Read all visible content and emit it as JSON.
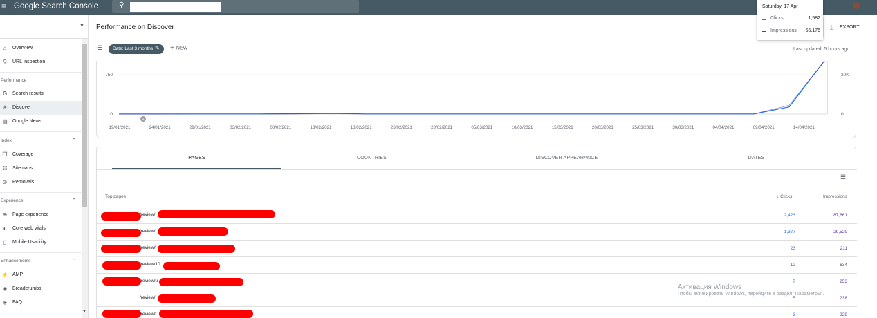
{
  "app": {
    "title": "Google Search Console"
  },
  "search": {
    "placeholder": ""
  },
  "tooltip": {
    "date": "Saturday, 17 Apr",
    "rows": [
      {
        "label": "Clicks",
        "value": "1,582"
      },
      {
        "label": "Impressions",
        "value": "55,176"
      }
    ]
  },
  "nav": {
    "items": [
      {
        "label": "Overview",
        "icon": "home-icon"
      },
      {
        "label": "URL inspection",
        "icon": "search-icon"
      },
      {
        "label": "Search results",
        "icon": "google-g-icon"
      },
      {
        "label": "Discover",
        "icon": "asterisk-icon"
      },
      {
        "label": "Google News",
        "icon": "news-icon"
      },
      {
        "label": "Coverage",
        "icon": "copy-icon"
      },
      {
        "label": "Sitemaps",
        "icon": "sitemap-icon"
      },
      {
        "label": "Removals",
        "icon": "eye-off-icon"
      },
      {
        "label": "Page experience",
        "icon": "plus-circle-icon"
      },
      {
        "label": "Core web vitals",
        "icon": "gauge-icon"
      },
      {
        "label": "Mobile Usability",
        "icon": "phone-icon"
      },
      {
        "label": "AMP",
        "icon": "bolt-icon"
      },
      {
        "label": "Breadcrumbs",
        "icon": "layers-icon"
      },
      {
        "label": "FAQ",
        "icon": "layers-icon"
      }
    ],
    "sections": [
      "Performance",
      "Index",
      "Experience",
      "Enhancements"
    ]
  },
  "header": {
    "title": "Performance on Discover",
    "export_label": "EXPORT",
    "last_updated": "Last updated: 5 hours ago"
  },
  "filters": {
    "date_chip": "Date: Last 3 months",
    "new_label": "NEW"
  },
  "chart_data": {
    "type": "line",
    "x": [
      "19/01/2021",
      "24/01/2021",
      "29/01/2021",
      "03/02/2021",
      "08/02/2021",
      "13/02/2021",
      "18/02/2021",
      "23/02/2021",
      "28/02/2021",
      "05/03/2021",
      "10/03/2021",
      "15/03/2021",
      "20/03/2021",
      "25/03/2021",
      "30/03/2021",
      "04/04/2021",
      "09/04/2021",
      "14/04/2021"
    ],
    "series": [
      {
        "name": "Clicks",
        "color": "#1a73e8",
        "values": [
          2,
          2,
          3,
          3,
          4,
          8,
          20,
          4,
          3,
          3,
          3,
          3,
          3,
          3,
          3,
          3,
          3,
          3,
          3,
          180,
          1582
        ]
      },
      {
        "name": "Impressions",
        "color": "#5e35b1",
        "values": [
          20,
          20,
          30,
          30,
          40,
          90,
          250,
          40,
          30,
          30,
          30,
          30,
          30,
          30,
          30,
          30,
          30,
          30,
          30,
          6000,
          55176
        ]
      }
    ],
    "yleft_ticks": [
      "0",
      "750"
    ],
    "yright_ticks": [
      "0",
      "20K"
    ],
    "ylim_left": [
      0,
      1000
    ],
    "ylim_right": [
      0,
      27000
    ]
  },
  "table": {
    "tabs": [
      "PAGES",
      "COUNTRIES",
      "DISCOVER APPEARANCE",
      "DATES"
    ],
    "header_left": "Top pages",
    "header_clicks": "Clicks",
    "header_impressions": "Impressions",
    "rows": [
      {
        "path": "/review/",
        "clicks": "2,423",
        "impressions": "87,661"
      },
      {
        "path": "/review/",
        "clicks": "1,377",
        "impressions": "29,529"
      },
      {
        "path": "/review/t",
        "clicks": "23",
        "impressions": "211"
      },
      {
        "path": "/review/10",
        "clicks": "12",
        "impressions": "634"
      },
      {
        "path": "/review/u",
        "clicks": "7",
        "impressions": "253"
      },
      {
        "path": "/review/",
        "clicks": "5",
        "impressions": "238"
      },
      {
        "path": "/review/t",
        "clicks": "3",
        "impressions": "229"
      }
    ]
  },
  "watermark": {
    "line1": "Активация Windows",
    "line2": "Чтобы активировать Windows, перейдите в раздел \"Параметры\"."
  }
}
